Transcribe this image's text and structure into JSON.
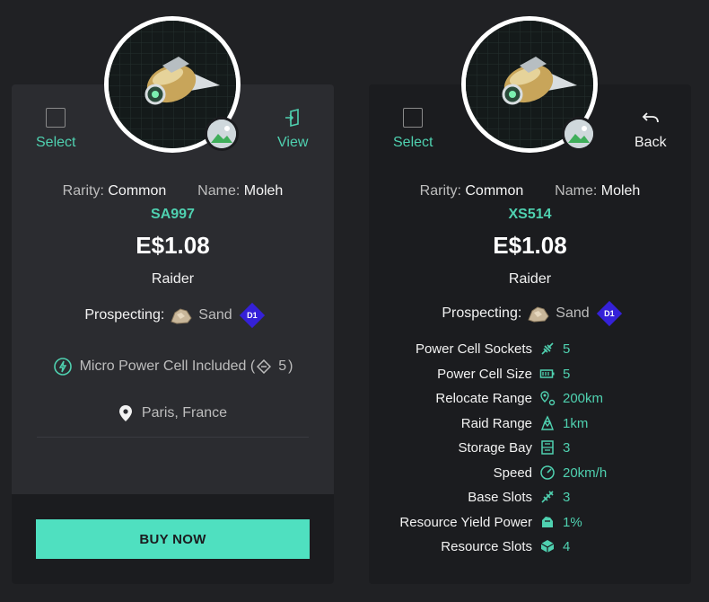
{
  "colors": {
    "accent": "#4fd1b0",
    "button": "#4fe0c0",
    "panel_left": "#2b2c30",
    "panel_right": "#1b1c1f",
    "tier_badge": "#3521d8"
  },
  "card_a": {
    "select_label": "Select",
    "view_label": "View",
    "rarity_label": "Rarity:",
    "rarity_value": "Common",
    "name_label": "Name:",
    "name_value": "Moleh",
    "code": "SA997",
    "price": "E$1.08",
    "role": "Raider",
    "prospecting_label": "Prospecting:",
    "prospecting_value": "Sand",
    "tier": "D1",
    "power_text": "Micro Power Cell Included (",
    "power_count": "5",
    "power_close": ")",
    "location": "Paris, France",
    "buy_label": "BUY NOW"
  },
  "card_b": {
    "select_label": "Select",
    "back_label": "Back",
    "rarity_label": "Rarity:",
    "rarity_value": "Common",
    "name_label": "Name:",
    "name_value": "Moleh",
    "code": "XS514",
    "price": "E$1.08",
    "role": "Raider",
    "prospecting_label": "Prospecting:",
    "prospecting_value": "Sand",
    "tier": "D1",
    "stats": [
      {
        "label": "Power Cell Sockets",
        "value": "5",
        "icon": "socket-icon"
      },
      {
        "label": "Power Cell Size",
        "value": "5",
        "icon": "battery-icon"
      },
      {
        "label": "Relocate Range",
        "value": "200km",
        "icon": "relocate-icon"
      },
      {
        "label": "Raid Range",
        "value": "1km",
        "icon": "raid-icon"
      },
      {
        "label": "Storage Bay",
        "value": "3",
        "icon": "storage-icon"
      },
      {
        "label": "Speed",
        "value": "20km/h",
        "icon": "speed-icon"
      },
      {
        "label": "Base Slots",
        "value": "3",
        "icon": "base-slots-icon"
      },
      {
        "label": "Resource Yield Power",
        "value": "1%",
        "icon": "yield-icon"
      },
      {
        "label": "Resource Slots",
        "value": "4",
        "icon": "resource-slots-icon"
      }
    ]
  }
}
